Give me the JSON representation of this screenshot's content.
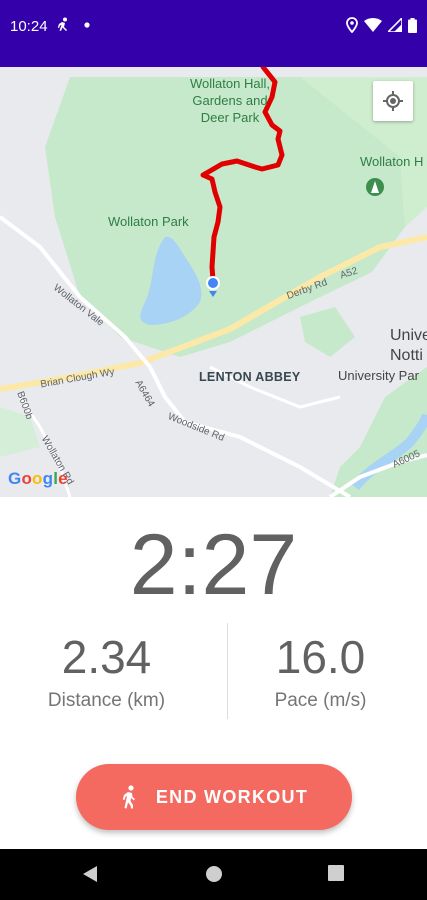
{
  "status_bar": {
    "time": "10:24",
    "background_color": "#3300aa",
    "left_icons": [
      "running-icon",
      "notification-dot-icon"
    ],
    "right_icons": [
      "location-pin-icon",
      "wifi-icon",
      "cell-signal-icon",
      "battery-icon"
    ]
  },
  "map": {
    "labels": {
      "wollaton_hall": "Wollaton Hall,\nGardens and\nDeer Park",
      "wollaton_park": "Wollaton Park",
      "wollaton_top_right": "Wollaton H",
      "lenton_abbey": "LENTON ABBEY",
      "university_1": "Unive",
      "university_2": "Notti",
      "university_park": "University Par",
      "derby_rd": "Derby Rd",
      "a52": "A52",
      "brian_clough": "Brian Clough Wy",
      "wollaton_vale": "Wollaton Vale",
      "a6464": "A6464",
      "woodside_rd": "Woodside Rd",
      "b6004": "B600b",
      "wollaton_rd": "Wollaton Rd",
      "a6005": "A6005"
    },
    "google_logo": [
      "G",
      "o",
      "o",
      "g",
      "l",
      "e"
    ],
    "locate_button_icon": "my-location-icon",
    "route_color": "#e00000"
  },
  "workout": {
    "timer": "2:27",
    "distance_value": "2.34",
    "distance_label": "Distance (km)",
    "pace_value": "16.0",
    "pace_label": "Pace (m/s)"
  },
  "end_button": {
    "label": "END WORKOUT",
    "icon": "walking-icon",
    "color": "#f46a60"
  },
  "nav_bar": {
    "items": [
      "back-icon",
      "home-icon",
      "recents-icon"
    ]
  }
}
